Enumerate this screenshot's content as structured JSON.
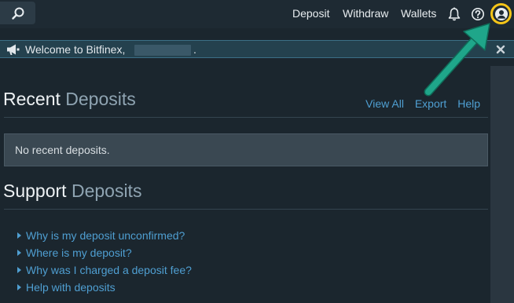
{
  "nav": {
    "deposit": "Deposit",
    "withdraw": "Withdraw",
    "wallets": "Wallets"
  },
  "icons": {
    "search": "search-icon",
    "bell": "bell-icon",
    "help": "help-circle-icon",
    "account": "account-icon",
    "megaphone": "megaphone-icon",
    "close": "close-icon"
  },
  "banner": {
    "text": "Welcome to Bitfinex,",
    "suffix": "."
  },
  "recent": {
    "title_strong": "Recent",
    "title_light": "Deposits",
    "links": [
      "View All",
      "Export",
      "Help"
    ],
    "empty": "No recent deposits."
  },
  "support": {
    "title_strong": "Support",
    "title_light": "Deposits",
    "items": [
      "Why is my deposit unconfirmed?",
      "Where is my deposit?",
      "Why was I charged a deposit fee?",
      "Help with deposits"
    ]
  },
  "colors": {
    "background": "#1b262e",
    "link": "#4f9fd2",
    "highlight_ring": "#f5c518",
    "annotation_arrow": "#1fa68a"
  }
}
